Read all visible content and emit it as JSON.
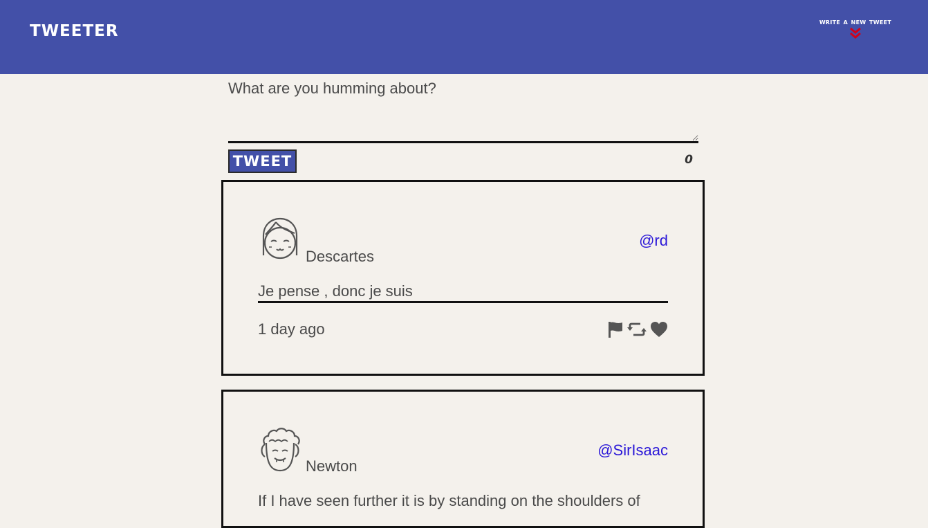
{
  "nav": {
    "brand": "Tweeter",
    "compose_label": "write a new tweet",
    "compose_icon": "double-chevron-down-icon",
    "compose_icon_color": "#d0021b"
  },
  "composer": {
    "placeholder": "What are you humming about?",
    "value": "",
    "submit_label": "Tweet",
    "counter": "0"
  },
  "colors": {
    "nav_bg": "#4350a8",
    "page_bg": "#f4f1ec",
    "handle": "#2a17d8",
    "text": "#4a4a4a"
  },
  "tweets": [
    {
      "avatar_icon": "girl-avatar-icon",
      "name": "Descartes",
      "handle": "@rd",
      "text": "Je pense , donc je suis",
      "time": "1 day ago",
      "actions": [
        "flag-icon",
        "retweet-icon",
        "heart-icon"
      ]
    },
    {
      "avatar_icon": "curly-hair-avatar-icon",
      "name": "Newton",
      "handle": "@SirIsaac",
      "text": "If I have seen further it is by standing on the shoulders of",
      "time": "",
      "actions": []
    }
  ]
}
